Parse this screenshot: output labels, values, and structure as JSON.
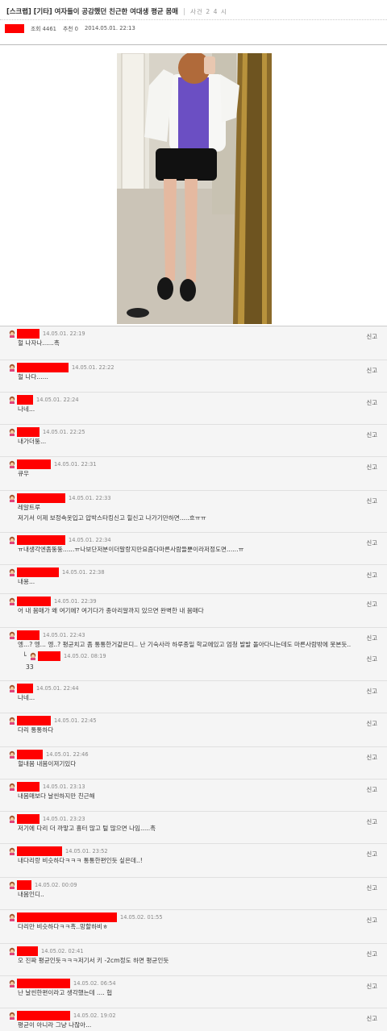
{
  "post": {
    "title": "[스크랩] [기타] 여자들이 공감했던 친근한 여대생 평균 몸매",
    "time_label": "사건 2 4 시",
    "views_label": "조회 4461",
    "likes_label": "추천 0",
    "date_label": "2014.05.01. 22:13"
  },
  "comments": [
    {
      "date": "14.05.01. 22:19",
      "body": "헐 나자나......흑",
      "report": "신고",
      "icon": "avatar-icon"
    },
    {
      "date": "14.05.01. 22:22",
      "body": "헐 나다......",
      "report": "신고",
      "icon": "avatar-icon"
    },
    {
      "date": "14.05.01. 22:24",
      "body": "나네...",
      "report": "신고",
      "icon": "avatar-icon"
    },
    {
      "date": "14.05.01. 22:25",
      "body": "내가더뚱...",
      "report": "신고",
      "icon": "avatar-icon"
    },
    {
      "date": "14.05.01. 22:31",
      "body": "큐우",
      "report": "신고",
      "icon": "avatar-icon"
    },
    {
      "date": "14.05.01. 22:33",
      "body": "레알트루",
      "body2": "저기서 이제 보정속옷입고 압박스타킹신고 힐신고 나가기만하면.....흐ㅠㅠ",
      "report": "신고",
      "icon": "avatar-icon"
    },
    {
      "date": "14.05.01. 22:34",
      "body": "ㅠ내생각엔좀뚱뚱......ㅠ나보단저분이더말랑지만요즘다마른사람들뿐이라저정도면......ㅠ",
      "report": "신고",
      "icon": "avatar-icon"
    },
    {
      "date": "14.05.01. 22:38",
      "body": "내용...",
      "report": "신고",
      "icon": "avatar-icon"
    },
    {
      "date": "14.05.01. 22:39",
      "body": "어 내 몸매가 왜 여기에? 여기다가 종아리알까지 있으면 완벽한 내 몸매다",
      "report": "신고",
      "icon": "avatar-icon"
    },
    {
      "date": "14.05.01. 22:43",
      "body": "엥...? 엥... 엥..? 평균치고 좀 통통한거같은디.. 난 기숙사라 하루종일 학교에있고 엄청 발발 돌아다니는데도 마른사람밖에 못본듯..",
      "report": "신고",
      "icon": "avatar-icon"
    },
    {
      "date": "14.05.02. 08:19",
      "body": "33",
      "report": "신고",
      "icon": "avatar-icon",
      "reply": true
    },
    {
      "date": "14.05.01. 22:44",
      "body": "나네...",
      "report": "신고",
      "icon": "avatar-icon"
    },
    {
      "date": "14.05.01. 22:45",
      "body": "다리 통통하다",
      "report": "신고",
      "icon": "avatar-icon"
    },
    {
      "date": "14.05.01. 22:46",
      "body": "헐내몸 내몸이져기있다",
      "report": "신고",
      "icon": "avatar-icon"
    },
    {
      "date": "14.05.01. 23:13",
      "body": "내몸매보다 날씬하지만 친근해",
      "report": "신고",
      "icon": "avatar-icon"
    },
    {
      "date": "14.05.01. 23:23",
      "body": "저기에 다리 더 까맣고 흉터 많고 털 많으면 나임.....흑",
      "report": "신고",
      "icon": "avatar-icon"
    },
    {
      "date": "14.05.01. 23:52",
      "body": "내다리랑 비슷하다ㅋㅋㅋ 통통한편인듯 싶은데..!",
      "report": "신고",
      "icon": "avatar-icon"
    },
    {
      "date": "14.05.02. 00:09",
      "body": "내몸인디..",
      "report": "신고",
      "icon": "avatar-icon"
    },
    {
      "date": "14.05.02. 01:55",
      "body": "다리만 비슷하다ㅋㅋ흑..망할하비ㅎ",
      "report": "신고",
      "icon": "avatar-icon"
    },
    {
      "date": "14.05.02. 02:41",
      "body": "오 진짜 평균인듯ㅋㅋㅋ저기서 키 -2cm정도 하면 평균인듯",
      "report": "신고",
      "icon": "avatar-icon"
    },
    {
      "date": "14.05.02. 06:54",
      "body": "난 날씬한편이라고 생각했는데 .... 헙",
      "report": "신고",
      "icon": "avatar-icon"
    },
    {
      "date": "14.05.02. 19:02",
      "body": "평균이 아니라 그냥 나잖아...",
      "report": "신고",
      "icon": "avatar-icon"
    }
  ]
}
